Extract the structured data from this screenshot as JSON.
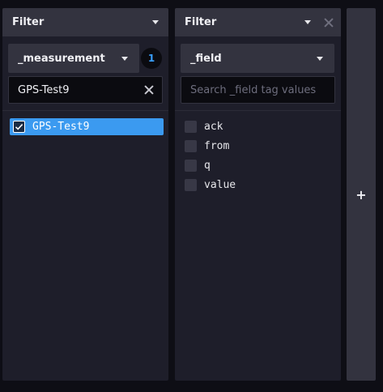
{
  "panel1": {
    "header": {
      "title": "Filter"
    },
    "key_dropdown": {
      "value": "_measurement"
    },
    "selected_count": "1",
    "search": {
      "value": "GPS-Test9"
    },
    "items": [
      {
        "label": "GPS-Test9",
        "checked": true
      }
    ]
  },
  "panel2": {
    "header": {
      "title": "Filter"
    },
    "key_dropdown": {
      "value": "_field"
    },
    "search": {
      "placeholder": "Search _field tag values"
    },
    "items": [
      {
        "label": "ack",
        "checked": false
      },
      {
        "label": "from",
        "checked": false
      },
      {
        "label": "q",
        "checked": false
      },
      {
        "label": "value",
        "checked": false
      }
    ]
  },
  "add_column": {
    "label": "+"
  },
  "colors": {
    "accent": "#3b9af0",
    "badge_text": "#3aa0ff"
  },
  "icons": [
    "caret-down-icon",
    "close-icon",
    "check-icon",
    "plus-icon"
  ]
}
